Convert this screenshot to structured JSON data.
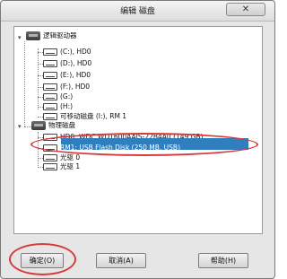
{
  "window": {
    "title": "编辑 磁盘",
    "close_glyph": "✕"
  },
  "tree": {
    "groups": [
      {
        "label": "逻辑驱动器",
        "children": [
          "(C:), HD0",
          "(D:), HD0",
          "(E:), HD0",
          "(F:), HD0",
          "(G:)",
          "(H:)",
          "可移动磁盘 (I:), RM 1"
        ]
      },
      {
        "label": "物理磁盘",
        "children": [
          "HD0: WDC WD1600AAJS-22B4A0 (149 GB)",
          "RM1: USB    Flash Disk (250 MB, USB)",
          "光驱 0",
          "光驱 1"
        ]
      }
    ],
    "selected": "RM1: USB    Flash Disk (250 MB, USB)"
  },
  "buttons": {
    "ok": "确定(O)",
    "cancel": "取消(A)",
    "help": "帮助(H)"
  },
  "colors": {
    "selection": "#2f7fbf",
    "annotation_circle": "#d83a3a"
  }
}
